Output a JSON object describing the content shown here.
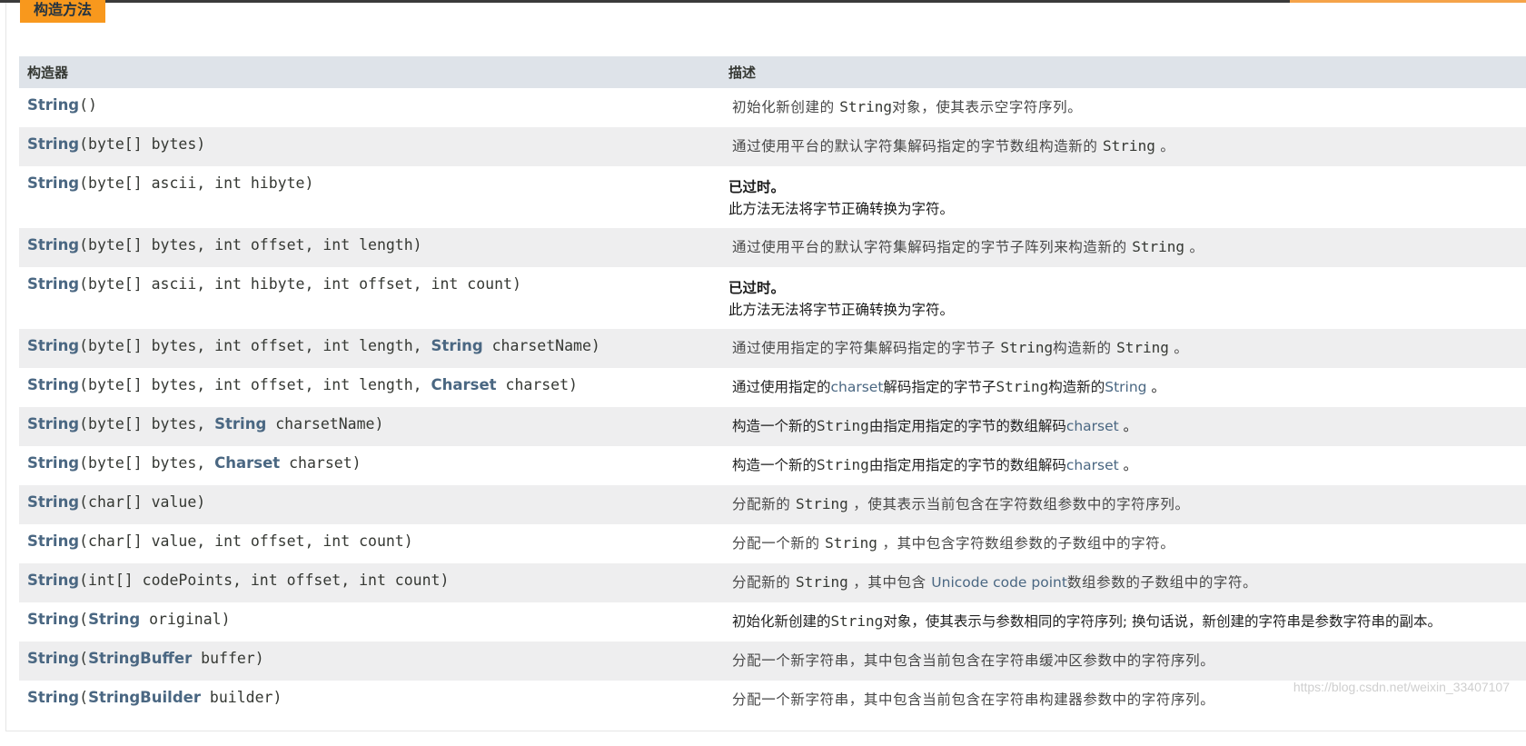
{
  "section": {
    "title": "构造方法"
  },
  "table": {
    "headers": {
      "constructor": "构造器",
      "description": "描述"
    },
    "rows": [
      {
        "sig": [
          {
            "t": "String",
            "k": "type"
          },
          {
            "t": "()",
            "k": "text"
          }
        ],
        "desc": [
          {
            "t": "初始化新创建的 ",
            "k": "text"
          },
          {
            "t": "String",
            "k": "code"
          },
          {
            "t": "对象，使其表示空字符序列。",
            "k": "text"
          }
        ],
        "deprecated": false,
        "tall": false,
        "dark": false
      },
      {
        "sig": [
          {
            "t": "String",
            "k": "type"
          },
          {
            "t": "(byte[] bytes)",
            "k": "text"
          }
        ],
        "desc": [
          {
            "t": "通过使用平台的默认字符集解码指定的字节数组构造新的 ",
            "k": "text"
          },
          {
            "t": "String",
            "k": "code"
          },
          {
            "t": " 。",
            "k": "text"
          }
        ],
        "deprecated": false,
        "tall": false,
        "dark": false
      },
      {
        "sig": [
          {
            "t": "String",
            "k": "type"
          },
          {
            "t": "(byte[] ascii, int hibyte)",
            "k": "text"
          }
        ],
        "deprecated": true,
        "depr_title": "已过时。",
        "depr_text": "此方法无法将字节正确转换为字符。",
        "tall": true
      },
      {
        "sig": [
          {
            "t": "String",
            "k": "type"
          },
          {
            "t": "(byte[] bytes, int offset, int length)",
            "k": "text"
          }
        ],
        "desc": [
          {
            "t": "通过使用平台的默认字符集解码指定的字节子阵列来构造新的 ",
            "k": "text"
          },
          {
            "t": "String",
            "k": "code"
          },
          {
            "t": " 。",
            "k": "text"
          }
        ],
        "deprecated": false,
        "tall": false,
        "dark": false
      },
      {
        "sig": [
          {
            "t": "String",
            "k": "type"
          },
          {
            "t": "(byte[] ascii, int hibyte, int offset, int count)",
            "k": "text"
          }
        ],
        "deprecated": true,
        "depr_title": "已过时。",
        "depr_text": "此方法无法将字节正确转换为字符。",
        "tall": true
      },
      {
        "sig": [
          {
            "t": "String",
            "k": "type"
          },
          {
            "t": "(byte[] bytes, int offset, int length, ",
            "k": "text"
          },
          {
            "t": "String",
            "k": "type"
          },
          {
            "t": " charsetName)",
            "k": "text"
          }
        ],
        "desc": [
          {
            "t": "通过使用指定的字符集解码指定的字节子 ",
            "k": "text"
          },
          {
            "t": "String",
            "k": "code"
          },
          {
            "t": "构造新的 ",
            "k": "text"
          },
          {
            "t": "String",
            "k": "code"
          },
          {
            "t": " 。",
            "k": "text"
          }
        ],
        "deprecated": false,
        "tall": false,
        "dark": false
      },
      {
        "sig": [
          {
            "t": "String",
            "k": "type"
          },
          {
            "t": "(byte[] bytes, int offset, int length, ",
            "k": "text"
          },
          {
            "t": "Charset",
            "k": "type"
          },
          {
            "t": " charset)",
            "k": "text"
          }
        ],
        "desc": [
          {
            "t": "通过使用指定的",
            "k": "text"
          },
          {
            "t": "charset",
            "k": "link"
          },
          {
            "t": "解码指定的字节子",
            "k": "text"
          },
          {
            "t": "String",
            "k": "code"
          },
          {
            "t": "构造新的",
            "k": "text"
          },
          {
            "t": "String",
            "k": "link"
          },
          {
            "t": " 。",
            "k": "text"
          }
        ],
        "deprecated": false,
        "tall": false,
        "dark": true
      },
      {
        "sig": [
          {
            "t": "String",
            "k": "type"
          },
          {
            "t": "(byte[] bytes, ",
            "k": "text"
          },
          {
            "t": "String",
            "k": "type"
          },
          {
            "t": " charsetName)",
            "k": "text"
          }
        ],
        "desc": [
          {
            "t": "构造一个新的",
            "k": "text"
          },
          {
            "t": "String",
            "k": "code"
          },
          {
            "t": "由指定用指定的字节的数组解码",
            "k": "text"
          },
          {
            "t": "charset",
            "k": "link"
          },
          {
            "t": " 。",
            "k": "text"
          }
        ],
        "deprecated": false,
        "tall": false,
        "dark": true
      },
      {
        "sig": [
          {
            "t": "String",
            "k": "type"
          },
          {
            "t": "(byte[] bytes, ",
            "k": "text"
          },
          {
            "t": "Charset",
            "k": "type"
          },
          {
            "t": " charset)",
            "k": "text"
          }
        ],
        "desc": [
          {
            "t": "构造一个新的",
            "k": "text"
          },
          {
            "t": "String",
            "k": "code"
          },
          {
            "t": "由指定用指定的字节的数组解码",
            "k": "text"
          },
          {
            "t": "charset",
            "k": "link"
          },
          {
            "t": " 。",
            "k": "text"
          }
        ],
        "deprecated": false,
        "tall": false,
        "dark": true
      },
      {
        "sig": [
          {
            "t": "String",
            "k": "type"
          },
          {
            "t": "(char[] value)",
            "k": "text"
          }
        ],
        "desc": [
          {
            "t": "分配新的 ",
            "k": "text"
          },
          {
            "t": "String",
            "k": "code"
          },
          {
            "t": " ，使其表示当前包含在字符数组参数中的字符序列。",
            "k": "text"
          }
        ],
        "deprecated": false,
        "tall": false,
        "dark": false
      },
      {
        "sig": [
          {
            "t": "String",
            "k": "type"
          },
          {
            "t": "(char[] value, int offset, int count)",
            "k": "text"
          }
        ],
        "desc": [
          {
            "t": "分配一个新的 ",
            "k": "text"
          },
          {
            "t": "String",
            "k": "code"
          },
          {
            "t": " ，其中包含字符数组参数的子数组中的字符。",
            "k": "text"
          }
        ],
        "deprecated": false,
        "tall": false,
        "dark": false
      },
      {
        "sig": [
          {
            "t": "String",
            "k": "type"
          },
          {
            "t": "(int[] codePoints, int offset, int count)",
            "k": "text"
          }
        ],
        "desc": [
          {
            "t": "分配新的 ",
            "k": "text"
          },
          {
            "t": "String",
            "k": "code"
          },
          {
            "t": " ，其中包含 ",
            "k": "text"
          },
          {
            "t": "Unicode code point",
            "k": "link"
          },
          {
            "t": "数组参数的子数组中的字符。",
            "k": "text"
          }
        ],
        "deprecated": false,
        "tall": false,
        "dark": false
      },
      {
        "sig": [
          {
            "t": "String",
            "k": "type"
          },
          {
            "t": "(",
            "k": "text"
          },
          {
            "t": "String",
            "k": "type"
          },
          {
            "t": " original)",
            "k": "text"
          }
        ],
        "desc": [
          {
            "t": "初始化新创建的",
            "k": "text"
          },
          {
            "t": "String",
            "k": "code"
          },
          {
            "t": "对象，使其表示与参数相同的字符序列; 换句话说，新创建的字符串是参数字符串的副本。",
            "k": "text"
          }
        ],
        "deprecated": false,
        "tall": false,
        "dark": true
      },
      {
        "sig": [
          {
            "t": "String",
            "k": "type"
          },
          {
            "t": "(",
            "k": "text"
          },
          {
            "t": "StringBuffer",
            "k": "type"
          },
          {
            "t": " buffer)",
            "k": "text"
          }
        ],
        "desc": [
          {
            "t": "分配一个新字符串，其中包含当前包含在字符串缓冲区参数中的字符序列。",
            "k": "text"
          }
        ],
        "deprecated": false,
        "tall": false,
        "dark": false
      },
      {
        "sig": [
          {
            "t": "String",
            "k": "type"
          },
          {
            "t": "(",
            "k": "text"
          },
          {
            "t": "StringBuilder",
            "k": "type"
          },
          {
            "t": " builder)",
            "k": "text"
          }
        ],
        "desc": [
          {
            "t": "分配一个新字符串，其中包含当前包含在字符串构建器参数中的字符序列。",
            "k": "text"
          }
        ],
        "deprecated": false,
        "tall": false,
        "dark": false
      }
    ]
  },
  "watermark": "https://blog.csdn.net/weixin_33407107"
}
